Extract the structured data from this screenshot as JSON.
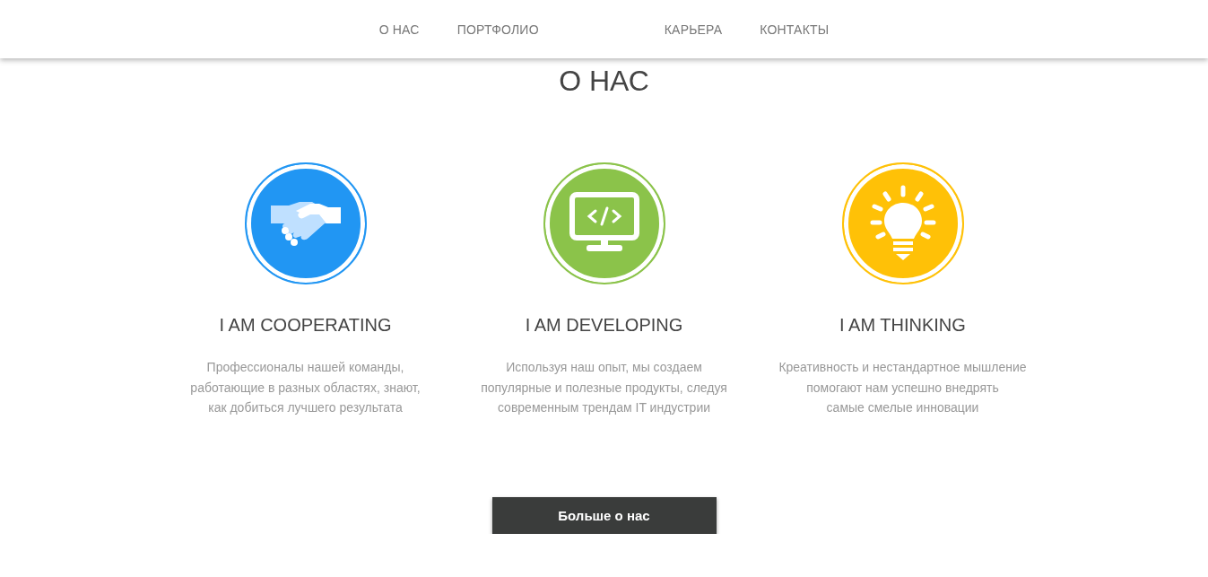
{
  "nav": {
    "left": [
      "О НАС",
      "ПОРТФОЛИО"
    ],
    "right": [
      "КАРЬЕРА",
      "КОНТАКТЫ"
    ]
  },
  "section": {
    "title": "О НАС",
    "features": [
      {
        "kind": "handshake",
        "color": "#2196f3",
        "title": "I AM COOPERATING",
        "lines": [
          "Профессионалы нашей команды,",
          "работающие в разных областях, знают,",
          "как добиться лучшего результата"
        ]
      },
      {
        "kind": "monitor",
        "color": "#8bc34a",
        "title": "I AM DEVELOPING",
        "lines": [
          "Используя наш опыт, мы создаем",
          "популярные и полезные продукты, следуя",
          "современным трендам IT индустрии"
        ]
      },
      {
        "kind": "bulb",
        "color": "#ffc107",
        "title": "I AM THINKING",
        "lines": [
          "Креативность и нестандартное мышление",
          "помогают нам успешно внедрять",
          "самые смелые инновации"
        ]
      }
    ],
    "button": "Больше о нас"
  }
}
